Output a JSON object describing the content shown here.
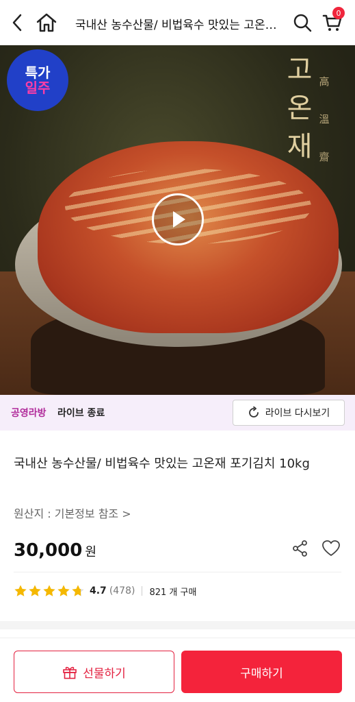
{
  "header": {
    "title": "국내산 농수산물/ 비법육수 맛있는 고온재 포기김치 10kg",
    "cart_count": "0",
    "icons": [
      "chevron-left-icon",
      "home-icon",
      "search-icon",
      "cart-icon"
    ]
  },
  "hero": {
    "badge_line1": "특가",
    "badge_line2": "일주",
    "brand_korean": [
      "고",
      "온",
      "재"
    ],
    "brand_hanja": [
      "高",
      "溫",
      "齋"
    ]
  },
  "live": {
    "host": "공영라방",
    "status": "라이브 종료",
    "replay_label": "라이브 다시보기"
  },
  "product": {
    "name": "국내산 농수산물/ 비법육수 맛있는 고온재 포기김치 10kg",
    "origin": "원산지 : 기본정보 참조 >",
    "price": "30,000",
    "currency": "원",
    "rating": "4.7",
    "rating_fraction": 0.94,
    "review_count": "(478)",
    "purchase_count": "821 개 구매"
  },
  "actions": {
    "gift_label": "선물하기",
    "buy_label": "구매하기"
  },
  "colors": {
    "accent": "#f4233b",
    "live_host": "#b02a9a",
    "star": "#f5b800"
  }
}
